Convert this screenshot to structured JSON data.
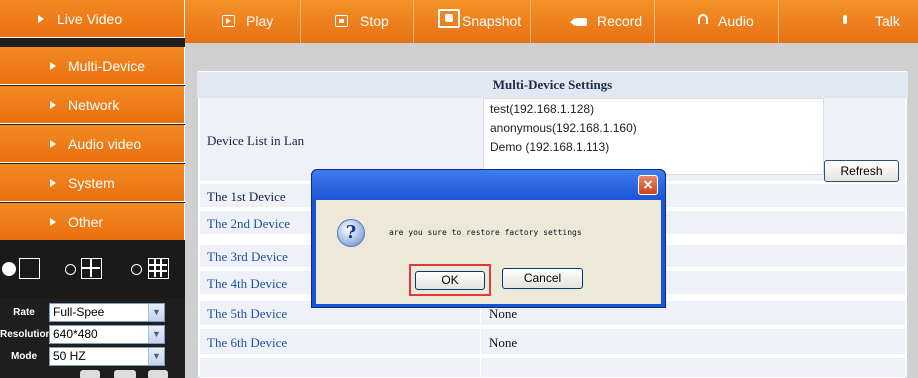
{
  "sidebar": {
    "menu": [
      {
        "label": "Live Video"
      },
      {
        "label": "Multi-Device"
      },
      {
        "label": "Network"
      },
      {
        "label": "Audio video"
      },
      {
        "label": "System"
      },
      {
        "label": "Other"
      }
    ],
    "layout_options": [
      "single-view",
      "quad-view",
      "nine-view"
    ],
    "layout_selected": "single-view",
    "controls": [
      {
        "label": "Rate",
        "value": "Full-Spee"
      },
      {
        "label": "Resolution",
        "value": "640*480"
      },
      {
        "label": "Mode",
        "value": "50 HZ"
      }
    ]
  },
  "toolbar": {
    "buttons": [
      {
        "label": "Play",
        "icon": "play-icon"
      },
      {
        "label": "Stop",
        "icon": "stop-icon"
      },
      {
        "label": "Snapshot",
        "icon": "camera-icon"
      },
      {
        "label": "Record",
        "icon": "video-camera-icon"
      },
      {
        "label": "Audio",
        "icon": "headphones-icon"
      },
      {
        "label": "Talk",
        "icon": "microphone-icon"
      }
    ]
  },
  "settings": {
    "title": "Multi-Device Settings",
    "device_list_label": "Device List in Lan",
    "device_list": [
      "test(192.168.1.128)",
      "anonymous(192.168.1.160)",
      "Demo (192.168.1.113)"
    ],
    "refresh_label": "Refresh",
    "devices": [
      {
        "label": "The 1st Device",
        "value": ""
      },
      {
        "label": "The 2nd Device",
        "value": ""
      },
      {
        "label": "The 3rd Device",
        "value": ""
      },
      {
        "label": "The 4th Device",
        "value": ""
      },
      {
        "label": "The 5th Device",
        "value": "None"
      },
      {
        "label": "The 6th Device",
        "value": "None"
      }
    ]
  },
  "dialog": {
    "close_glyph": "×",
    "icon_glyph": "?",
    "message": "are you sure to restore factory settings",
    "ok_label": "OK",
    "cancel_label": "Cancel"
  },
  "colors": {
    "menu_orange": "#ee7d1b",
    "header_bg": "#e2e8f2",
    "row_bg": "#eef2f8",
    "dialog_blue": "#1b53d6",
    "ok_highlight": "#e0393e"
  }
}
